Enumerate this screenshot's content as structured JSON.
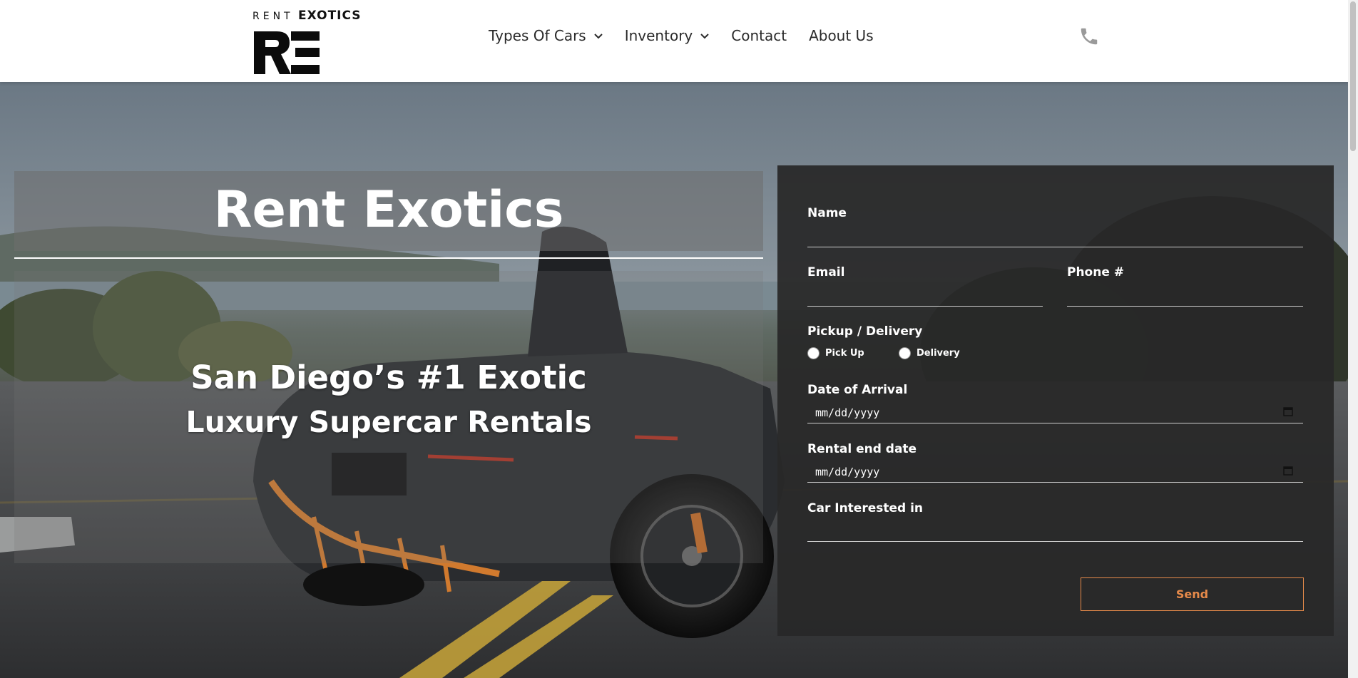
{
  "brand": {
    "logo_top_light": "RENT",
    "logo_top_bold": "EXOTICS",
    "logo_mark": "RE"
  },
  "nav": {
    "items": [
      {
        "label": "Types Of Cars",
        "has_dropdown": true
      },
      {
        "label": "Inventory",
        "has_dropdown": true
      },
      {
        "label": "Contact",
        "has_dropdown": false
      },
      {
        "label": "About Us",
        "has_dropdown": false
      }
    ],
    "phone_icon": "phone-icon"
  },
  "hero": {
    "title": "Rent Exotics",
    "subtitle_line1": "San Diego’s #1 Exotic",
    "subtitle_line2": "Luxury Supercar Rentals"
  },
  "form": {
    "name_label": "Name",
    "email_label": "Email",
    "phone_label": "Phone #",
    "pickup_label": "Pickup / Delivery",
    "pickup_option": "Pick Up",
    "delivery_option": "Delivery",
    "arrival_label": "Date of Arrival",
    "arrival_placeholder": "mm/dd/yyyy",
    "end_label": "Rental end date",
    "end_placeholder": "mm/dd/yyyy",
    "car_label": "Car Interested in",
    "send_label": "Send"
  },
  "colors": {
    "accent": "#e68a4a",
    "form_bg": "#282828",
    "header_bg": "#ffffff"
  }
}
